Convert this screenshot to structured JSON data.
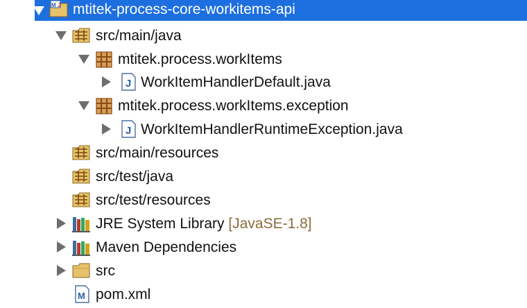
{
  "tree": {
    "project": {
      "label": "mtitek-process-core-workitems-api",
      "icon": "maven-project-icon",
      "expanded": true,
      "selected": true
    },
    "src_main_java": {
      "label": "src/main/java",
      "icon": "source-folder-icon",
      "expanded": true
    },
    "pkg_workitems": {
      "label": "mtitek.process.workItems",
      "icon": "package-icon",
      "expanded": true
    },
    "file_default": {
      "label": "WorkItemHandlerDefault.java",
      "icon": "java-file-icon",
      "expanded": false
    },
    "pkg_exception": {
      "label": "mtitek.process.workItems.exception",
      "icon": "package-icon",
      "expanded": true
    },
    "file_runtime": {
      "label": "WorkItemHandlerRuntimeException.java",
      "icon": "java-file-icon",
      "expanded": false
    },
    "src_main_resources": {
      "label": "src/main/resources",
      "icon": "source-folder-icon"
    },
    "src_test_java": {
      "label": "src/test/java",
      "icon": "source-folder-icon"
    },
    "src_test_resources": {
      "label": "src/test/resources",
      "icon": "source-folder-icon"
    },
    "jre": {
      "label": "JRE System Library",
      "suffix": "[JavaSE-1.8]",
      "icon": "library-icon",
      "expanded": false
    },
    "maven_deps": {
      "label": "Maven Dependencies",
      "icon": "library-icon",
      "expanded": false
    },
    "src": {
      "label": "src",
      "icon": "folder-icon",
      "expanded": false
    },
    "pom": {
      "label": "pom.xml",
      "icon": "maven-file-icon"
    }
  },
  "colors": {
    "selection": "#1d6fe0",
    "decoration": "#8a6d3b",
    "package": "#b5651d",
    "folder": "#e8c26a"
  }
}
